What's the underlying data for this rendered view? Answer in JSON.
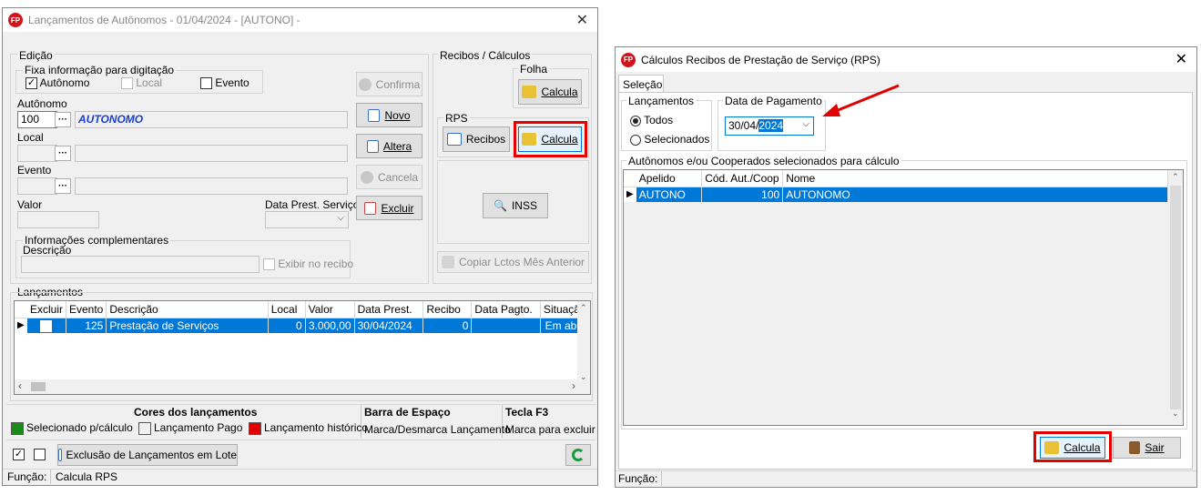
{
  "left": {
    "title": "Lançamentos de Autônomos -  01/04/2024 - [AUTONO] -",
    "edicao": {
      "group_label": "Edição",
      "fixa_label": "Fixa informação para digitação",
      "chk_autonomo": "Autônomo",
      "chk_local": "Local",
      "chk_evento": "Evento",
      "autonomo_label": "Autônomo",
      "autonomo_code": "100",
      "autonomo_name": "AUTONOMO",
      "local_label": "Local",
      "evento_label": "Evento",
      "valor_label": "Valor",
      "data_prest_label": "Data Prest. Serviço",
      "info_label": "Informações complementares",
      "descricao_label": "Descrição",
      "exibir_label": "Exibir no recibo",
      "lookup": "···"
    },
    "buttons": {
      "confirma": "Confirma",
      "novo": "Novo",
      "altera": "Altera",
      "cancela": "Cancela",
      "excluir": "Excluir"
    },
    "recibos": {
      "group_label": "Recibos / Cálculos",
      "folha_label": "Folha",
      "folha_calcula": "Calcula",
      "rps_label": "RPS",
      "recibos_btn": "Recibos",
      "rps_calcula": "Calcula",
      "inss_btn": "INSS",
      "copiar_btn": "Copiar Lctos Mês Anterior"
    },
    "lancamentos": {
      "group_label": "Lançamentos",
      "columns": [
        "Excluir",
        "Evento",
        "Descrição",
        "Local",
        "Valor",
        "Data Prest.",
        "Recibo",
        "Data Pagto.",
        "Situação"
      ],
      "row": {
        "evento": "125",
        "descricao": "Prestação de Serviços",
        "local": "0",
        "valor": "3.000,00",
        "data_prest": "30/04/2024",
        "recibo": "0",
        "data_pagto": "",
        "situacao": "Em aber"
      }
    },
    "legend": {
      "cores_title": "Cores dos lançamentos",
      "barra_title": "Barra de Espaço",
      "f3_title": "Tecla F3",
      "selecionado": "Selecionado p/cálculo",
      "pago": "Lançamento Pago",
      "historico": "Lançamento histórico",
      "marca": "Marca/Desmarca Lançamento",
      "marca_excluir": "Marca para excluir",
      "colors": {
        "selecionado": "#1a8a1a",
        "pago": "#f0f0f0",
        "historico": "#e00000"
      }
    },
    "bottom": {
      "exclusao_btn": "Exclusão de Lançamentos em Lote",
      "check_all": "✓"
    },
    "status": {
      "label": "Função:",
      "value": "Calcula RPS"
    }
  },
  "right": {
    "title": "Cálculos Recibos de Prestação de Serviço (RPS)",
    "tab": "Seleção",
    "lancamentos_label": "Lançamentos",
    "radio_todos": "Todos",
    "radio_selecionados": "Selecionados",
    "data_pagamento_label": "Data de Pagamento",
    "data_day": "30/04/",
    "data_year": "2024",
    "list_label": "Autônomos e/ou Cooperados selecionados para cálculo",
    "columns": [
      "Apelido",
      "Cód. Aut./Coop",
      "Nome"
    ],
    "row": {
      "apelido": "AUTONO",
      "codigo": "100",
      "nome": "AUTONOMO"
    },
    "calcula_btn": "Calcula",
    "sair_btn": "Sair",
    "status_label": "Função:"
  }
}
